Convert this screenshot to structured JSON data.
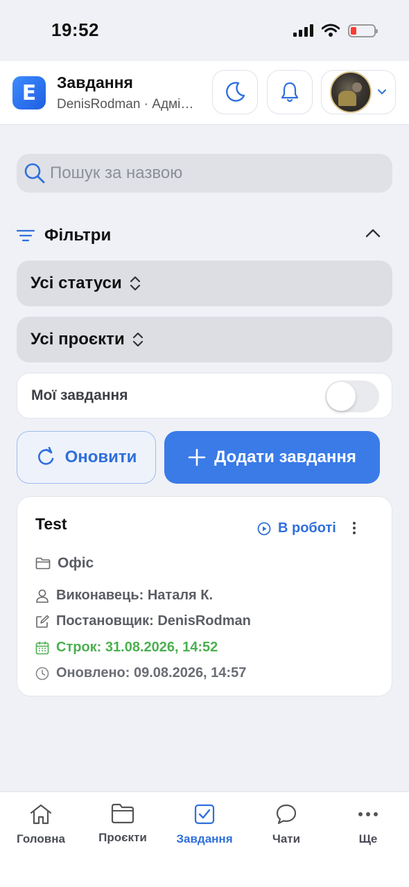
{
  "status_bar": {
    "time": "19:52",
    "battery_color": "#ff3b30"
  },
  "header": {
    "app_logo_letter": "E",
    "title": "Завдання",
    "subtitle": "DenisRodman · Адмі…",
    "icons": [
      "moon-icon",
      "bell-icon",
      "chevron-down-icon"
    ]
  },
  "search": {
    "placeholder": "Пошук за назвою",
    "value": ""
  },
  "filters": {
    "label": "Фільтри",
    "expanded": true,
    "status_select": "Усі статуси",
    "project_select": "Усі проєкти",
    "my_tasks_label": "Мої завдання",
    "my_tasks_on": false
  },
  "actions": {
    "refresh_label": "Оновити",
    "add_label": "Додати завдання",
    "accent": "#3a7be8"
  },
  "tasks": [
    {
      "title": "Test",
      "status": "В роботі",
      "project": "Офіс",
      "assignee": "Виконавець: Наталя К.",
      "creator": "Постановщик: DenisRodman",
      "deadline": "Строк: 31.08.2026, 14:52",
      "deadline_color": "#4caf50",
      "updated": "Оновлено: 09.08.2026, 14:57"
    }
  ],
  "bottom_nav": {
    "items": [
      {
        "label": "Головна",
        "icon": "home-icon"
      },
      {
        "label": "Проєкти",
        "icon": "folder-icon"
      },
      {
        "label": "Завдання",
        "icon": "checkbox-icon",
        "active": true
      },
      {
        "label": "Чати",
        "icon": "chat-icon"
      },
      {
        "label": "Ще",
        "icon": "more-icon"
      }
    ],
    "active_color": "#2f6fdc"
  }
}
